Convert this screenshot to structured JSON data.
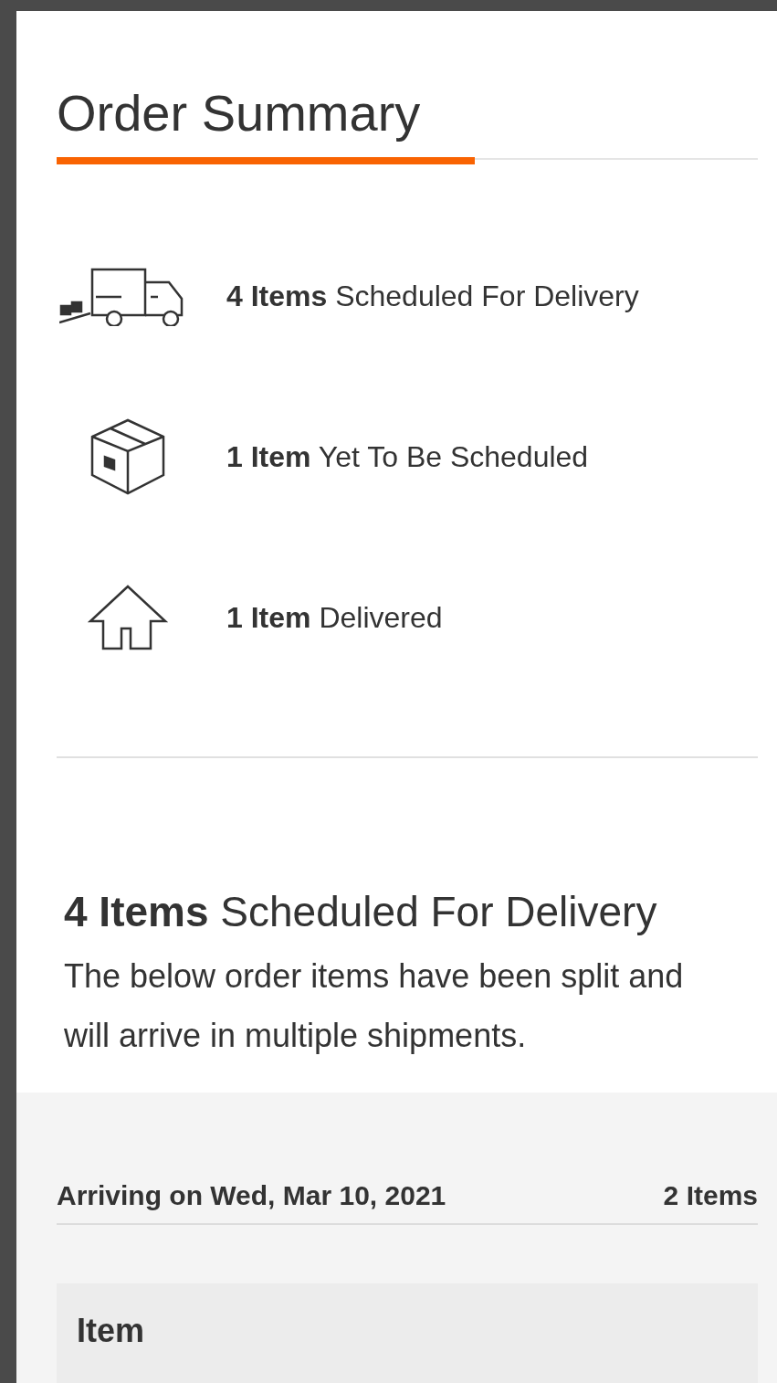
{
  "title": "Order Summary",
  "statuses": [
    {
      "kind": "truck",
      "text": "**4 Items** Scheduled For Delivery"
    },
    {
      "kind": "box",
      "text": "**1 Item** Yet To Be Scheduled"
    },
    {
      "kind": "house",
      "text": "**1 Item** Delivered"
    }
  ],
  "section": {
    "heading": "**4 Items** Scheduled For Delivery",
    "description": "The below order items have been split and will arrive in multiple shipments."
  },
  "shipment": {
    "arrival": "Arriving on Wed, Mar 10, 2021",
    "count": "2 Items",
    "column_header": "Item"
  }
}
